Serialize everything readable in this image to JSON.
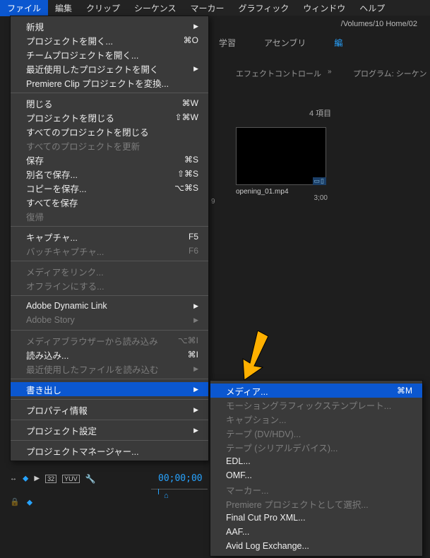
{
  "menubar": {
    "items": [
      "ファイル",
      "編集",
      "クリップ",
      "シーケンス",
      "マーカー",
      "グラフィック",
      "ウィンドウ",
      "ヘルプ"
    ],
    "active_index": 0
  },
  "breadcrumb": "/Volumes/10 Home/02",
  "workspace_tabs": {
    "learn": "学習",
    "assembly": "アセンブリ",
    "edit": "編"
  },
  "panels": {
    "effect_controls": "エフェクトコントロール",
    "program": "プログラム: シーケン"
  },
  "bin": {
    "item_count_label": "4 項目",
    "clip_name": "opening_01.mp4",
    "clip_duration": "3;00",
    "row_edge": "9"
  },
  "file_menu": [
    {
      "label": "新規",
      "arrow": true
    },
    {
      "label": "プロジェクトを開く...",
      "sc": "⌘O"
    },
    {
      "label": "チームプロジェクトを開く..."
    },
    {
      "label": "最近使用したプロジェクトを開く",
      "arrow": true
    },
    {
      "label": "Premiere Clip プロジェクトを変換..."
    },
    {
      "sep": true
    },
    {
      "label": "閉じる",
      "sc": "⌘W"
    },
    {
      "label": "プロジェクトを閉じる",
      "sc": "⇧⌘W"
    },
    {
      "label": "すべてのプロジェクトを閉じる"
    },
    {
      "label": "すべてのプロジェクトを更新",
      "disabled": true
    },
    {
      "label": "保存",
      "sc": "⌘S"
    },
    {
      "label": "別名で保存...",
      "sc": "⇧⌘S"
    },
    {
      "label": "コピーを保存...",
      "sc": "⌥⌘S"
    },
    {
      "label": "すべてを保存"
    },
    {
      "label": "復帰",
      "disabled": true
    },
    {
      "sep": true
    },
    {
      "label": "キャプチャ...",
      "sc": "F5"
    },
    {
      "label": "バッチキャプチャ...",
      "sc": "F6",
      "disabled": true
    },
    {
      "sep": true
    },
    {
      "label": "メディアをリンク...",
      "disabled": true
    },
    {
      "label": "オフラインにする...",
      "disabled": true
    },
    {
      "sep": true
    },
    {
      "label": "Adobe Dynamic Link",
      "arrow": true
    },
    {
      "label": "Adobe Story",
      "disabled": true,
      "arrow": true
    },
    {
      "sep": true
    },
    {
      "label": "メディアブラウザーから読み込み",
      "sc": "⌥⌘I",
      "disabled": true
    },
    {
      "label": "読み込み...",
      "sc": "⌘I"
    },
    {
      "label": "最近使用したファイルを読み込む",
      "disabled": true,
      "arrow": true
    },
    {
      "sep": true
    },
    {
      "label": "書き出し",
      "arrow": true,
      "hl": true
    },
    {
      "sep": true
    },
    {
      "label": "プロパティ情報",
      "arrow": true
    },
    {
      "sep": true
    },
    {
      "label": "プロジェクト設定",
      "arrow": true
    },
    {
      "sep": true
    },
    {
      "label": "プロジェクトマネージャー..."
    }
  ],
  "export_menu": [
    {
      "label": "メディア...",
      "sc": "⌘M",
      "hl": true
    },
    {
      "label": "モーショングラフィックステンプレート...",
      "disabled": true
    },
    {
      "label": "キャプション...",
      "disabled": true
    },
    {
      "label": "テープ (DV/HDV)...",
      "disabled": true
    },
    {
      "label": "テープ (シリアルデバイス)...",
      "disabled": true
    },
    {
      "label": "EDL..."
    },
    {
      "label": "OMF..."
    },
    {
      "label": "マーカー...",
      "disabled": true
    },
    {
      "label": "Premiere プロジェクトとして選択...",
      "disabled": true
    },
    {
      "label": "Final Cut Pro XML..."
    },
    {
      "label": "AAF..."
    },
    {
      "label": "Avid Log Exchange..."
    }
  ],
  "timeline": {
    "tc": "00;00;00",
    "badges": [
      "32",
      "YUV"
    ],
    "play_icon": "▶"
  }
}
